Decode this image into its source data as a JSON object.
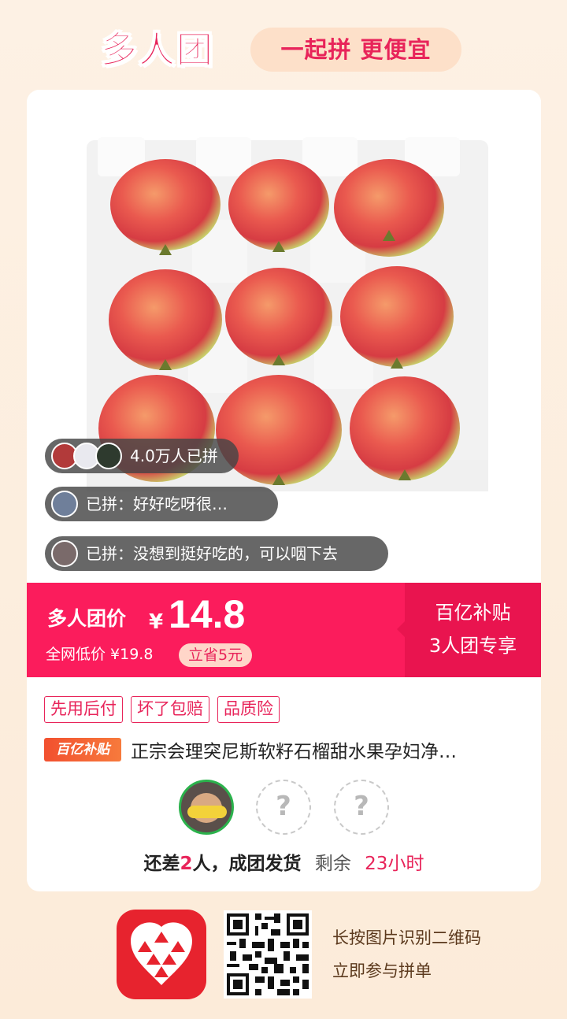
{
  "header": {
    "brand": "多人团",
    "slogan": "一起拼 更便宜"
  },
  "bubbles": [
    {
      "text": "4.0万人已拼"
    },
    {
      "text": "已拼：好好吃呀很…"
    },
    {
      "text": "已拼：没想到挺好吃的，可以咽下去"
    }
  ],
  "price": {
    "label": "多人团价",
    "currency": "¥",
    "value": "14.8",
    "original": "全网低价 ¥19.8",
    "save": "立省5元"
  },
  "subsidy": {
    "line1": "百亿补贴",
    "line2": "3人团专享"
  },
  "tags": [
    "先用后付",
    "坏了包赔",
    "品质险"
  ],
  "product": {
    "badge": "百亿补贴",
    "title": "正宗会理突尼斯软籽石榴甜水果孕妇净…"
  },
  "group": {
    "empty_slot": "?",
    "status_prefix": "还差",
    "remaining_count": "2",
    "status_suffix": "人，成团发货",
    "time_label": "剩余",
    "time_value": "23小时"
  },
  "footer": {
    "line1": "长按图片识别二维码",
    "line2": "立即参与拼单"
  },
  "colors": {
    "accent": "#fb1c5c",
    "accent_dark": "#e9144f",
    "success": "#2bb24c"
  }
}
